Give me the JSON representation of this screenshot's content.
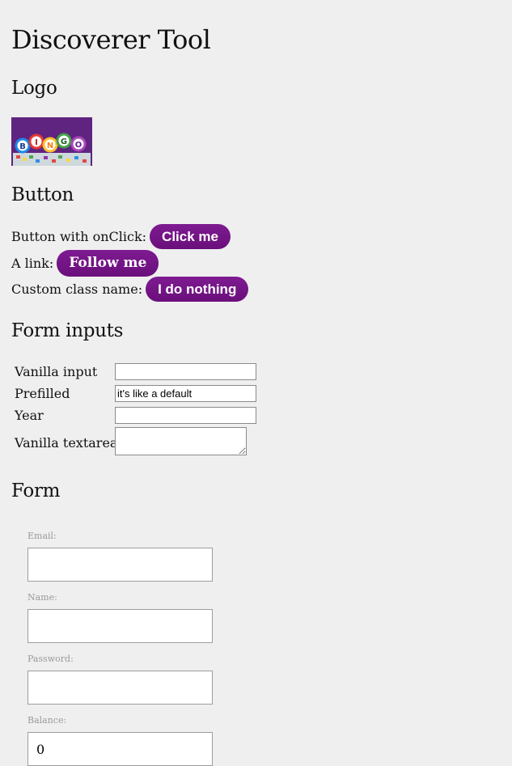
{
  "page": {
    "title": "Discoverer Tool"
  },
  "sections": {
    "logo": "Logo",
    "button": "Button",
    "form_inputs": "Form inputs",
    "form": "Form"
  },
  "logo": {
    "text": "BINGO",
    "colors": {
      "background": "#5f2480",
      "B": "#1e88e5",
      "I": "#e53935",
      "N": "#fdd835",
      "G": "#43a047",
      "O": "#8e24aa"
    }
  },
  "buttons": {
    "onclick_label": "Button with onClick:",
    "onclick_button": "Click me",
    "link_label": "A link:",
    "link_button": "Follow me",
    "custom_label": "Custom class name:",
    "custom_button": "I do nothing",
    "accent_color": "#741886"
  },
  "form_inputs": {
    "vanilla_label": "Vanilla input",
    "vanilla_value": "",
    "prefilled_label": "Prefilled",
    "prefilled_value": "it's like a default",
    "year_label": "Year",
    "year_value": "",
    "textarea_label": "Vanilla textarea",
    "textarea_value": ""
  },
  "form": {
    "email_label": "Email:",
    "email_value": "",
    "name_label": "Name:",
    "name_value": "",
    "password_label": "Password:",
    "password_value": "",
    "balance_label": "Balance:",
    "balance_value": "0"
  }
}
